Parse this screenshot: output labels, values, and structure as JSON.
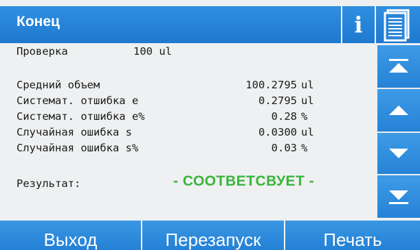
{
  "header": {
    "title": "Конец",
    "info_icon": "info-icon",
    "list_icon": "document-list-icon"
  },
  "check": {
    "label": "Проверка",
    "value": "100 ul"
  },
  "stats": [
    {
      "label": "Средний объем",
      "value": "100.2795",
      "unit": "ul"
    },
    {
      "label": "Системат. отшибка e",
      "value": "0.2795",
      "unit": "ul"
    },
    {
      "label": "Системат. отшибка e%",
      "value": "0.28",
      "unit": "%"
    },
    {
      "label": "Случайная ошибка s",
      "value": "0.0300",
      "unit": "ul"
    },
    {
      "label": "Случайная ошибка s%",
      "value": "0.03",
      "unit": "%"
    }
  ],
  "result": {
    "label": "Результат:",
    "value": "- СООТВЕТСВУЕТ -",
    "color": "#3ab53a"
  },
  "scroll": {
    "top_icon": "scroll-to-top-icon",
    "up_icon": "scroll-up-icon",
    "down_icon": "scroll-down-icon",
    "bottom_icon": "scroll-to-bottom-icon"
  },
  "footer": {
    "exit_label": "Выход",
    "restart_label": "Перезапуск",
    "print_label": "Печать"
  },
  "colors": {
    "accent": "#2585d8",
    "background": "#eef0f1"
  }
}
